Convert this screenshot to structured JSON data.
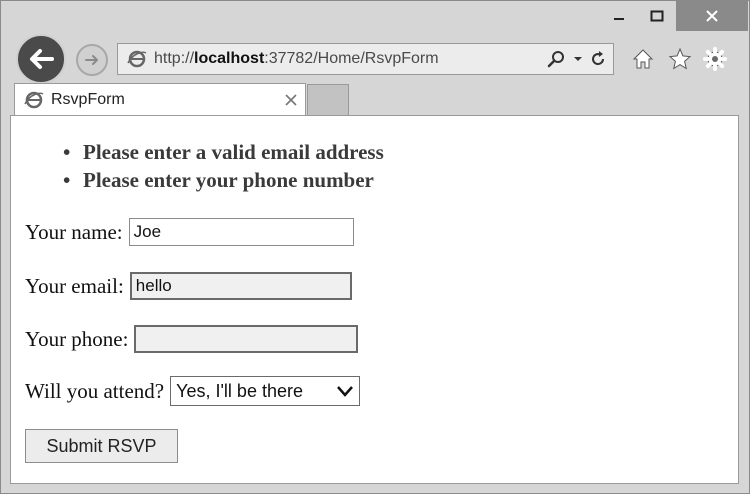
{
  "window": {
    "controls": {
      "minimize_icon": "minimize-icon",
      "maximize_icon": "maximize-icon",
      "close_icon": "close-icon"
    }
  },
  "address_bar": {
    "url_prefix": "http://",
    "url_host": "localhost",
    "url_rest": ":37782/Home/RsvpForm"
  },
  "tab": {
    "title": "RsvpForm"
  },
  "form": {
    "errors": [
      "Please enter a valid email address",
      "Please enter your phone number"
    ],
    "name_label": "Your name:",
    "name_value": "Joe",
    "email_label": "Your email:",
    "email_value": "hello",
    "phone_label": "Your phone:",
    "phone_value": "",
    "attend_label": "Will you attend?",
    "attend_value": "Yes, I'll be there",
    "submit_label": "Submit RSVP"
  }
}
